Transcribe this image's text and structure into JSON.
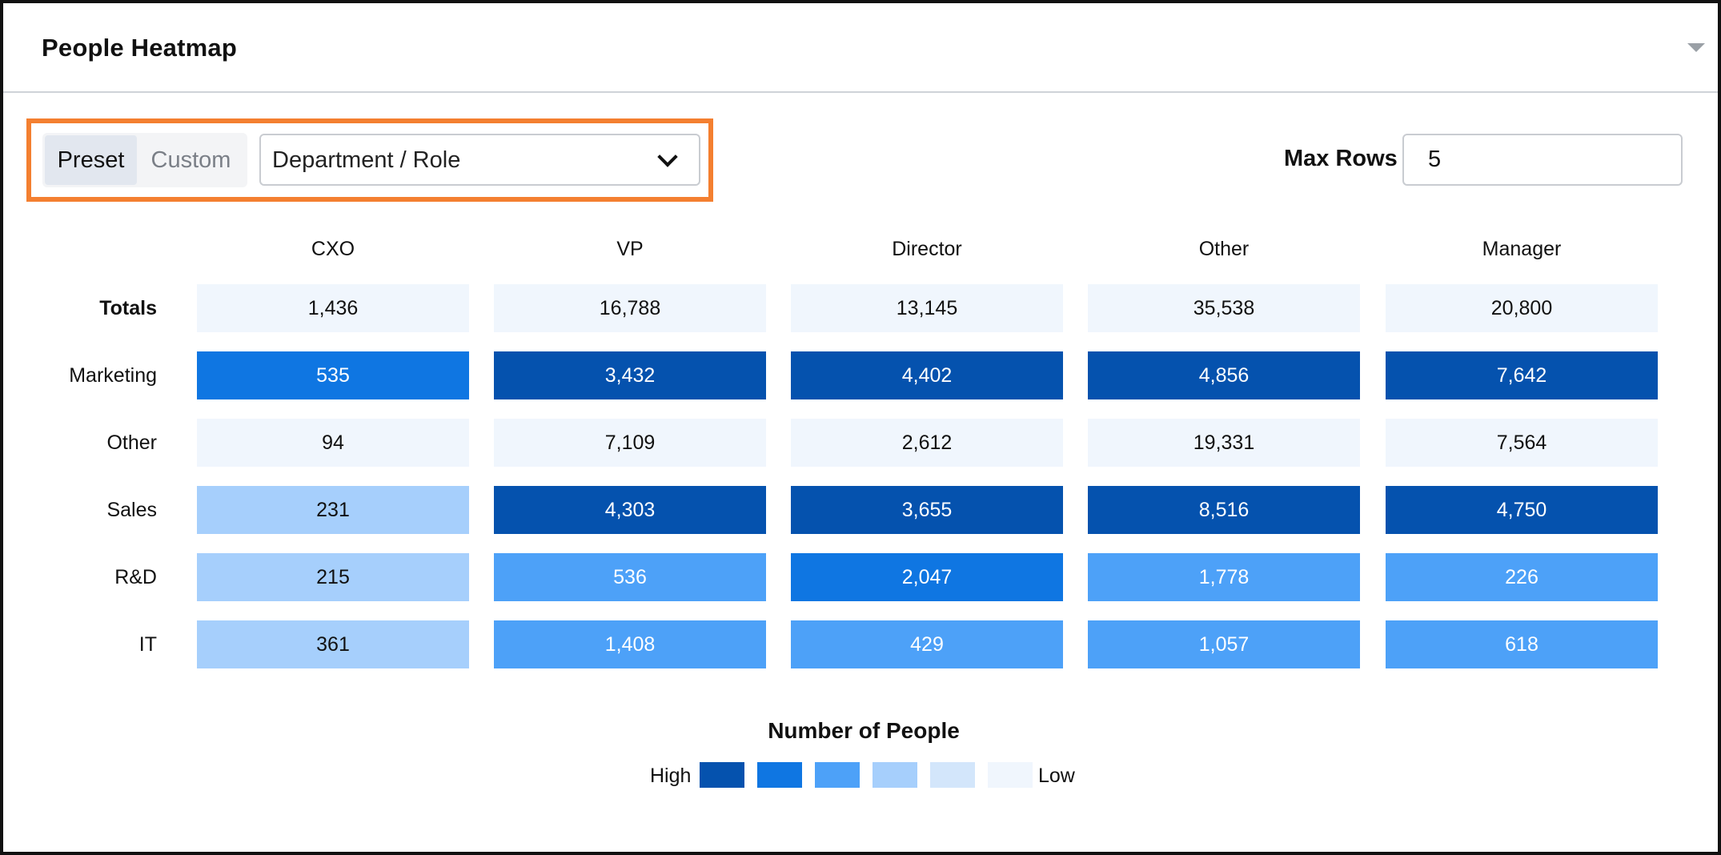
{
  "panel": {
    "title": "People Heatmap"
  },
  "toolbar": {
    "preset_label": "Preset",
    "custom_label": "Custom",
    "grouping_value": "Department / Role",
    "max_rows_label": "Max Rows",
    "max_rows_value": "5"
  },
  "chart_data": {
    "type": "heatmap",
    "columns": [
      "CXO",
      "VP",
      "Director",
      "Other",
      "Manager"
    ],
    "rows": [
      {
        "label": "Totals",
        "values": [
          "1,436",
          "16,788",
          "13,145",
          "35,538",
          "20,800"
        ],
        "levels": [
          1,
          1,
          1,
          1,
          1
        ]
      },
      {
        "label": "Marketing",
        "values": [
          "535",
          "3,432",
          "4,402",
          "4,856",
          "7,642"
        ],
        "levels": [
          5,
          6,
          6,
          6,
          6
        ]
      },
      {
        "label": "Other",
        "values": [
          "94",
          "7,109",
          "2,612",
          "19,331",
          "7,564"
        ],
        "levels": [
          1,
          1,
          1,
          1,
          1
        ]
      },
      {
        "label": "Sales",
        "values": [
          "231",
          "4,303",
          "3,655",
          "8,516",
          "4,750"
        ],
        "levels": [
          3,
          6,
          6,
          6,
          6
        ]
      },
      {
        "label": "R&D",
        "values": [
          "215",
          "536",
          "2,047",
          "1,778",
          "226"
        ],
        "levels": [
          3,
          4,
          5,
          4,
          4
        ]
      },
      {
        "label": "IT",
        "values": [
          "361",
          "1,408",
          "429",
          "1,057",
          "618"
        ],
        "levels": [
          3,
          4,
          4,
          4,
          4
        ]
      }
    ],
    "level_colors": {
      "1": "#f0f6fd",
      "2": "#d3e6fb",
      "3": "#a6cffc",
      "4": "#4da1f8",
      "5": "#0f76e2",
      "6": "#0552ae"
    },
    "level_text_colors": {
      "1": "#111111",
      "2": "#111111",
      "3": "#111111",
      "4": "#ffffff",
      "5": "#ffffff",
      "6": "#ffffff"
    },
    "legend": {
      "title": "Number of People",
      "high_label": "High",
      "low_label": "Low",
      "colors": [
        "#0552ae",
        "#0f76e2",
        "#4da1f8",
        "#a6cffc",
        "#d3e6fb",
        "#f0f6fd"
      ]
    }
  }
}
